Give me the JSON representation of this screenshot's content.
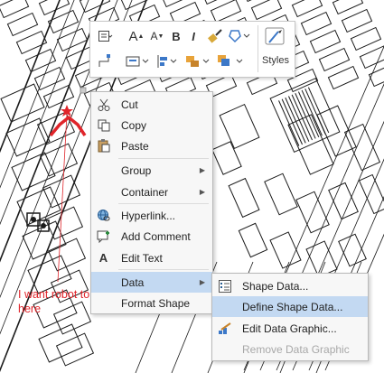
{
  "toolbar": {
    "row1": [
      "textbox-icon",
      "font-grow-icon",
      "font-shrink-icon",
      "bold-icon",
      "italic-icon",
      "format-painter-icon",
      "shape-fill-icon"
    ],
    "row2": [
      "connector-icon",
      "align-icon",
      "position-icon",
      "group-icon",
      "bring-front-icon"
    ],
    "styles_label": "Styles"
  },
  "context_menu": [
    {
      "label": "Cut",
      "icon": "scissors-icon"
    },
    {
      "label": "Copy",
      "icon": "copy-icon"
    },
    {
      "label": "Paste",
      "icon": "paste-icon"
    },
    {
      "label": "Group",
      "icon": "",
      "submenu": true
    },
    {
      "label": "Container",
      "icon": "",
      "submenu": true
    },
    {
      "label": "Hyperlink...",
      "icon": "globe-link-icon"
    },
    {
      "label": "Add Comment",
      "icon": "comment-icon"
    },
    {
      "label": "Edit Text",
      "icon": "text-a-icon"
    },
    {
      "label": "Data",
      "icon": "",
      "submenu": true,
      "highlighted": true
    },
    {
      "label": "Format Shape",
      "icon": ""
    }
  ],
  "data_submenu": [
    {
      "label": "Shape Data...",
      "icon": "shape-data-icon"
    },
    {
      "label": "Define Shape Data...",
      "icon": "",
      "highlighted": true
    },
    {
      "label": "Edit Data Graphic...",
      "icon": "edit-graphic-icon"
    },
    {
      "label": "Remove Data Graphic",
      "icon": "",
      "disabled": true
    }
  ],
  "annotation": {
    "line1": "I want robot to stop",
    "line2": "here",
    "color": "#e0242a"
  },
  "colors": {
    "highlight": "#c3d9f2",
    "menu_bg": "#f7f7f7",
    "drawing_line": "#1a1a1a"
  }
}
